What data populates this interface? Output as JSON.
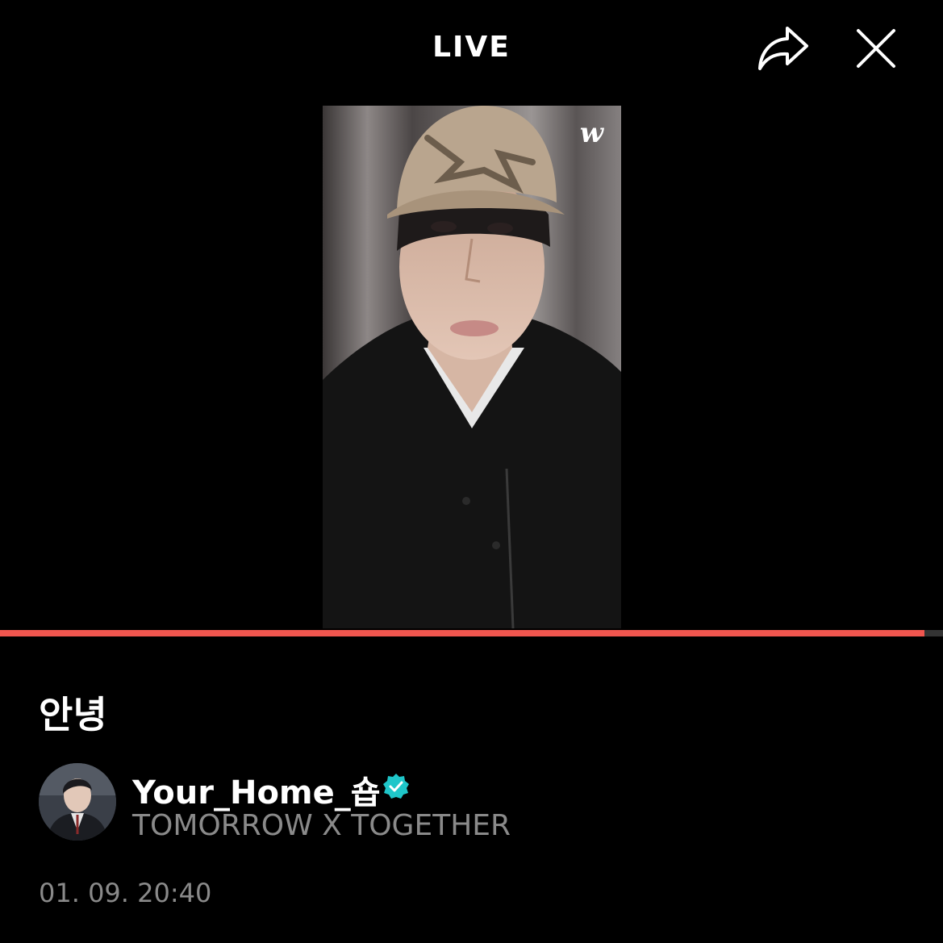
{
  "header": {
    "title": "LIVE",
    "share_icon": "share-icon",
    "close_icon": "close-icon"
  },
  "video": {
    "watermark": "w",
    "description": "",
    "progress_fraction": 0.98
  },
  "info": {
    "title": "안녕",
    "channel_name": "Your_Home_숍",
    "verified_icon": "verified-badge-icon",
    "group_name": "TOMORROW X TOGETHER",
    "timestamp": "01. 09. 20:40"
  },
  "colors": {
    "background": "#000000",
    "progress": "#f0564f",
    "verified": "#1fc6c9",
    "muted_text": "#8a8a8a"
  }
}
